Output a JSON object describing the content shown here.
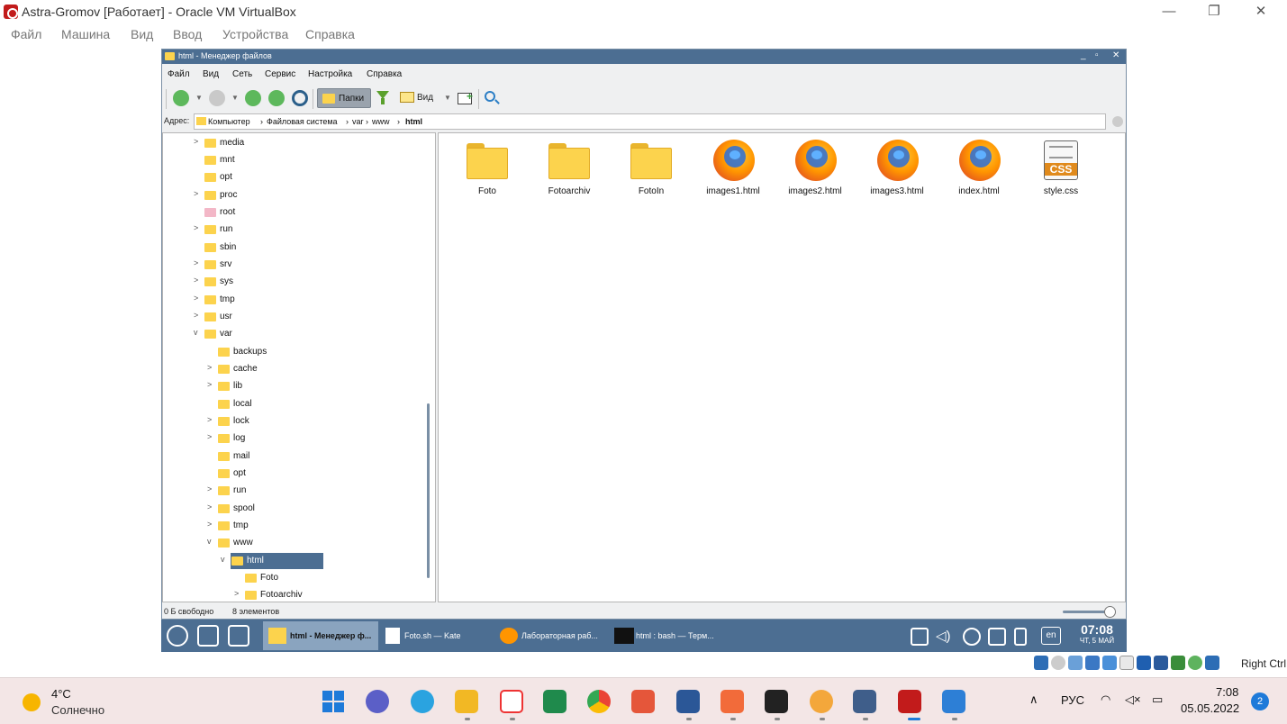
{
  "vbox": {
    "title": "Astra-Gromov [Работает] - Oracle VM VirtualBox",
    "menu": [
      "Файл",
      "Машина",
      "Вид",
      "Ввод",
      "Устройства",
      "Справка"
    ],
    "status_right": "Right Ctrl"
  },
  "fm": {
    "title": "html - Менеджер файлов",
    "menu": [
      "Файл",
      "Вид",
      "Сеть",
      "Сервис",
      "Настройка",
      "Справка"
    ],
    "toolbar": {
      "folders_label": "Папки",
      "view_label": "Вид"
    },
    "address": {
      "label": "Адрес:",
      "crumbs": [
        "Компьютер",
        "Файловая система",
        "var",
        "www",
        "html"
      ]
    },
    "tree": [
      {
        "label": "media",
        "expander": ">"
      },
      {
        "label": "mnt",
        "expander": ""
      },
      {
        "label": "opt",
        "expander": ""
      },
      {
        "label": "proc",
        "expander": ">"
      },
      {
        "label": "root",
        "expander": ""
      },
      {
        "label": "run",
        "expander": ">"
      },
      {
        "label": "sbin",
        "expander": ""
      },
      {
        "label": "srv",
        "expander": ">"
      },
      {
        "label": "sys",
        "expander": ">"
      },
      {
        "label": "tmp",
        "expander": ">"
      },
      {
        "label": "usr",
        "expander": ">"
      },
      {
        "label": "var",
        "expander": "v"
      },
      {
        "label": "backups",
        "expander": ""
      },
      {
        "label": "cache",
        "expander": ">"
      },
      {
        "label": "lib",
        "expander": ">"
      },
      {
        "label": "local",
        "expander": ""
      },
      {
        "label": "lock",
        "expander": ">"
      },
      {
        "label": "log",
        "expander": ">"
      },
      {
        "label": "mail",
        "expander": ""
      },
      {
        "label": "opt",
        "expander": ""
      },
      {
        "label": "run",
        "expander": ">"
      },
      {
        "label": "spool",
        "expander": ">"
      },
      {
        "label": "tmp",
        "expander": ">"
      },
      {
        "label": "www",
        "expander": "v"
      },
      {
        "label": "html",
        "expander": "v"
      },
      {
        "label": "Foto",
        "expander": ""
      },
      {
        "label": "Fotoarchiv",
        "expander": ">"
      }
    ],
    "files": [
      {
        "name": "Foto",
        "type": "folder"
      },
      {
        "name": "Fotoarchiv",
        "type": "folder"
      },
      {
        "name": "FotoIn",
        "type": "folder"
      },
      {
        "name": "images1.html",
        "type": "html"
      },
      {
        "name": "images2.html",
        "type": "html"
      },
      {
        "name": "images3.html",
        "type": "html"
      },
      {
        "name": "index.html",
        "type": "html"
      },
      {
        "name": "style.css",
        "type": "css"
      }
    ],
    "status": {
      "free": "0 Б свободно",
      "count": "8 элементов"
    }
  },
  "guest_taskbar": {
    "tasks": [
      "html - Менеджер ф...",
      "Foto.sh — Kate",
      "Лабораторная раб...",
      "html : bash — Терм..."
    ],
    "lang": "en",
    "time": "07:08",
    "date": "ЧТ, 5 МАЙ"
  },
  "win_taskbar": {
    "weather_temp": "4°C",
    "weather_cond": "Солнечно",
    "lang": "РУС",
    "time": "7:08",
    "date": "05.05.2022",
    "notifications": "2"
  },
  "colors": {
    "kde_blue": "#4c6e92",
    "folder_yellow": "#fcd34d",
    "win_taskbar": "#f3e6e6"
  }
}
